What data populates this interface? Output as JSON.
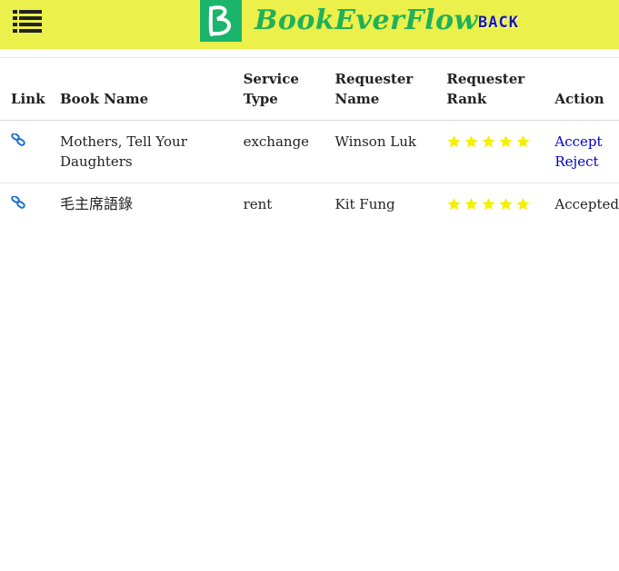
{
  "header": {
    "brand": "BookEverFlow",
    "back_label": "BACK"
  },
  "colors": {
    "header_bg": "#ecf04a",
    "brand_green": "#1fb15a",
    "logo_bg": "#1ab56b",
    "back_blue": "#1a1aa0",
    "link_blue": "#0000cc",
    "star_yellow": "#f3f000",
    "chain_blue": "#1a6fd0"
  },
  "table": {
    "headers": {
      "link": "Link",
      "book_name": "Book Name",
      "service_type": "Service Type",
      "requester_name": "Requester Name",
      "requester_rank": "Requester Rank",
      "action": "Action"
    },
    "rows": [
      {
        "link_icon": "link-icon",
        "book_name": "Mothers, Tell Your Daughters",
        "service_type": "exchange",
        "requester_name": "Winson Luk",
        "rank_stars": 5,
        "accept_label": "Accept",
        "reject_label": "Reject"
      },
      {
        "link_icon": "link-icon",
        "book_name": "毛主席語錄",
        "service_type": "rent",
        "requester_name": "Kit Fung",
        "rank_stars": 5,
        "status": "Accepted"
      }
    ]
  }
}
